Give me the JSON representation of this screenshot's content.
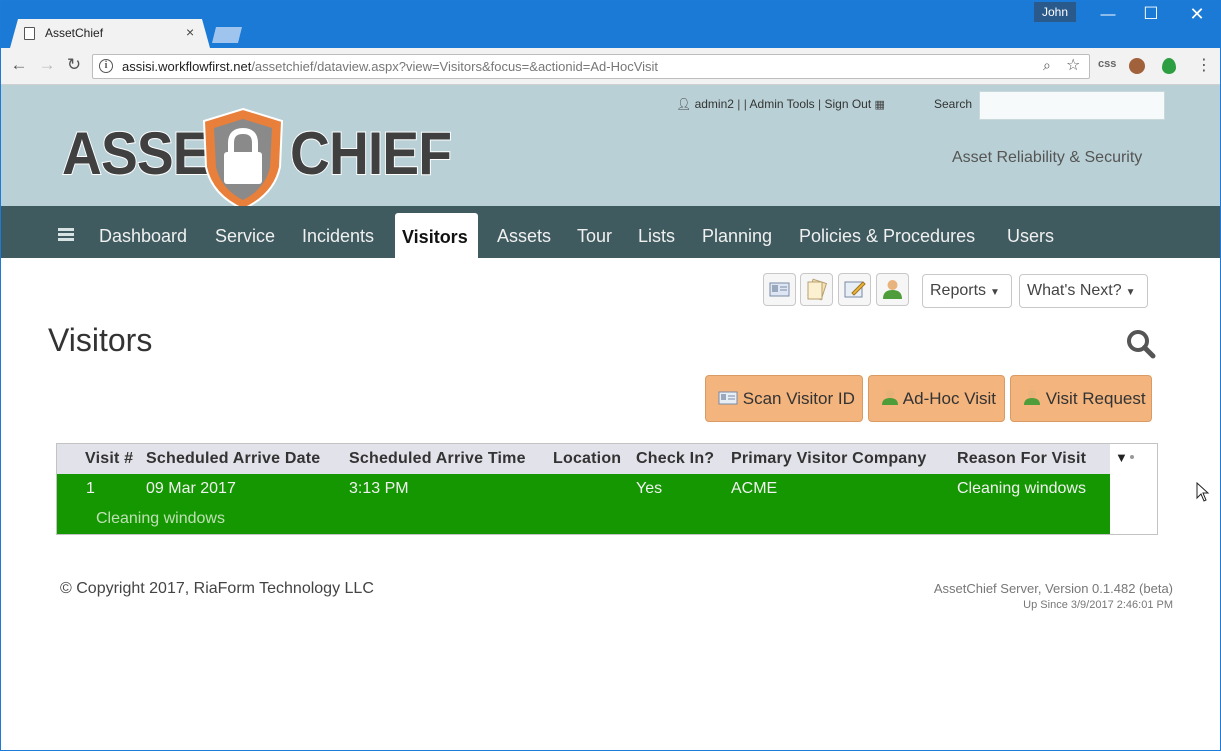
{
  "browser": {
    "tab_title": "AssetChief",
    "user_badge": "John",
    "url_host": "assisi.workflowfirst.net",
    "url_path": "/assetchief/dataview.aspx?view=Visitors&focus=&actionid=Ad-HocVisit",
    "extension_label": "css"
  },
  "header": {
    "user": "admin2",
    "sep1": "| |",
    "admin_tools": "Admin Tools",
    "sep2": "|",
    "sign_out": "Sign Out",
    "search_label": "Search",
    "search_value": "",
    "tagline": "Asset Reliability & Security",
    "logo_left": "ASSET",
    "logo_right": "CHIEF"
  },
  "nav": {
    "items": [
      "Dashboard",
      "Service",
      "Incidents",
      "Visitors",
      "Assets",
      "Tour",
      "Lists",
      "Planning",
      "Policies & Procedures",
      "Users"
    ],
    "active": "Visitors"
  },
  "toolbar": {
    "reports_label": "Reports",
    "whats_next_label": "What's Next?"
  },
  "page": {
    "title": "Visitors",
    "scan_button": "Scan Visitor ID",
    "adhoc_button": "Ad-Hoc Visit",
    "request_button": "Visit Request"
  },
  "table": {
    "columns": [
      "Visit #",
      "Scheduled Arrive Date",
      "Scheduled Arrive Time",
      "Location",
      "Check In?",
      "Primary Visitor Company",
      "Reason For Visit"
    ],
    "rows": [
      {
        "visit_no": "1",
        "date": "09 Mar 2017",
        "time": "3:13 PM",
        "location": "",
        "check_in": "Yes",
        "company": "ACME",
        "reason": "Cleaning windows",
        "detail": "Cleaning windows"
      }
    ]
  },
  "footer": {
    "copyright": "© Copyright 2017, RiaForm Technology LLC",
    "version": "AssetChief Server, Version 0.1.482 (beta)",
    "uptime": "Up Since 3/9/2017 2:46:01 PM"
  },
  "colors": {
    "chrome_blue": "#1a7ad6",
    "header_bg": "#b9d1d6",
    "nav_bg": "#3f5b60",
    "action_orange": "#f3b47d",
    "row_green": "#149701"
  }
}
